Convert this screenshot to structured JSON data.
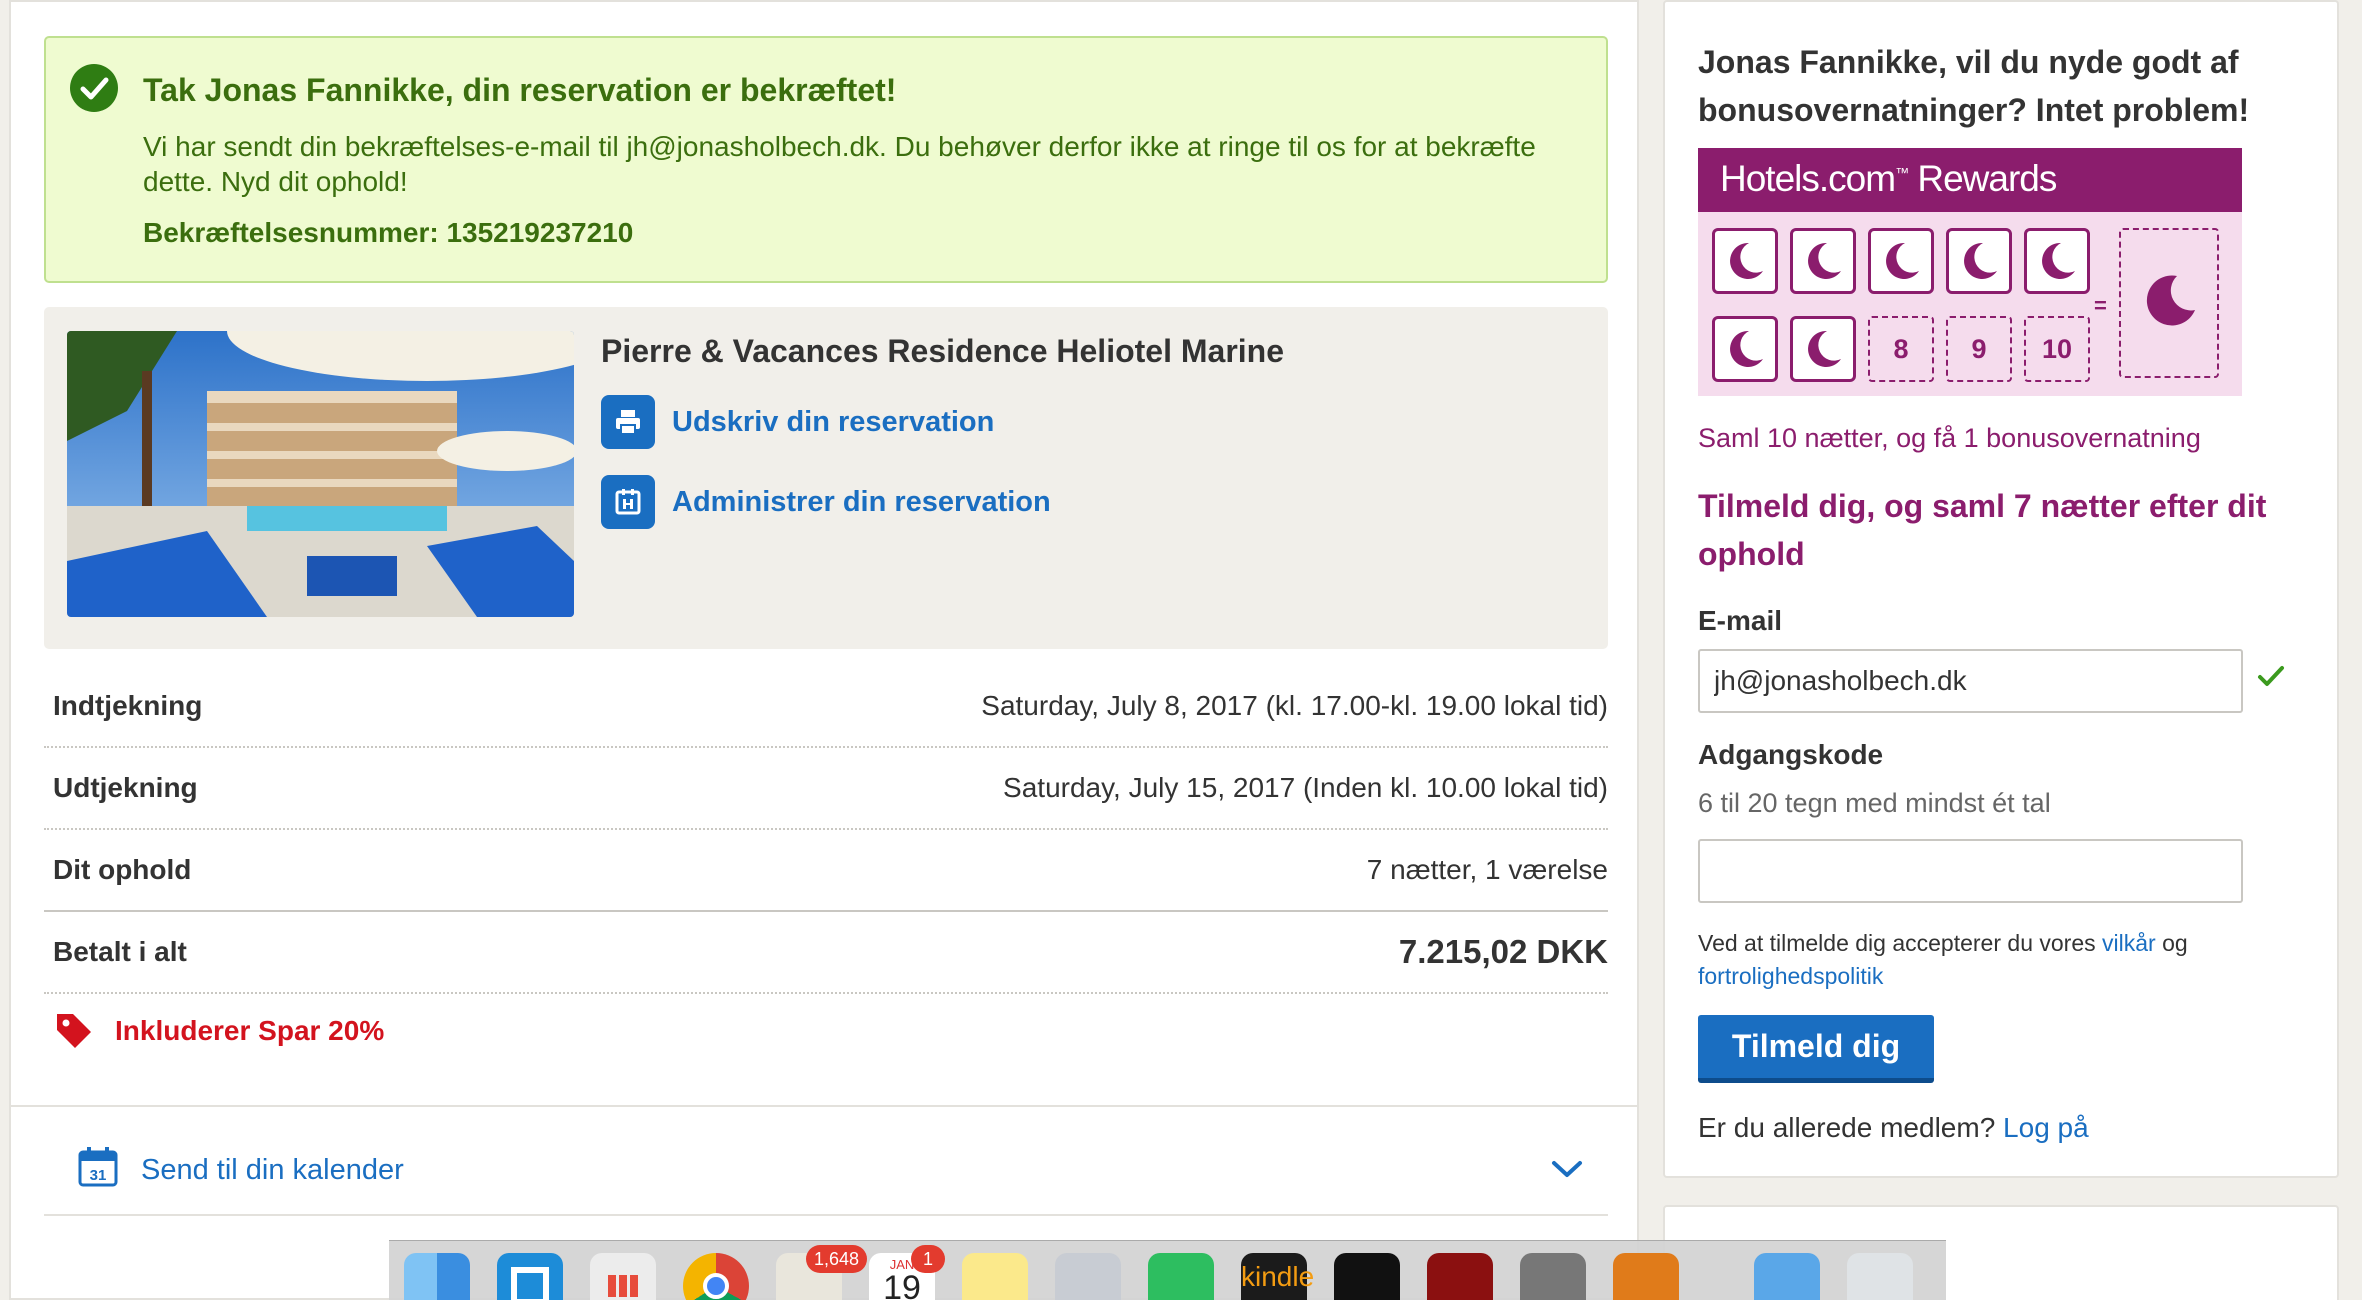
{
  "confirmation": {
    "title": "Tak Jonas Fannikke, din reservation er bekræftet!",
    "message": "Vi har sendt din bekræftelses-e-mail til jh@jonasholbech.dk. Du behøver derfor ikke at ringe til os for at bekræfte dette. Nyd dit ophold!",
    "number_label": "Bekræftelsesnummer: 135219237210"
  },
  "hotel": {
    "name": "Pierre & Vacances Residence Heliotel Marine",
    "print_label": "Udskriv din reservation",
    "manage_label": "Administrer din reservation"
  },
  "details": {
    "checkin": {
      "label": "Indtjekning",
      "value": "Saturday, July 8, 2017 (kl. 17.00-kl. 19.00 lokal tid)"
    },
    "checkout": {
      "label": "Udtjekning",
      "value": "Saturday, July 15, 2017 (Inden kl. 10.00 lokal tid)"
    },
    "stay": {
      "label": "Dit ophold",
      "value": "7 nætter, 1 værelse"
    },
    "total": {
      "label": "Betalt i alt",
      "value": "7.215,02 DKK"
    }
  },
  "discount_label": "Inkluderer Spar 20%",
  "calendar": {
    "label": "Send til din kalender",
    "icon_day": "31"
  },
  "sidebar": {
    "heading": "Jonas Fannikke, vil du nyde godt af bonusovernatninger? Intet problem!",
    "rewards": {
      "brand": "Hotels.com",
      "brand_suffix": "Rewards",
      "tm": "™",
      "empty_nights": [
        "8",
        "9",
        "10"
      ],
      "equals": "=",
      "collected_nights": 7,
      "caption": "Saml 10 nætter, og få 1 bonusovernatning"
    },
    "signup_heading": "Tilmeld dig, og saml 7 nætter efter dit ophold",
    "email_label": "E-mail",
    "email_value": "jh@jonasholbech.dk",
    "password_label": "Adgangskode",
    "password_hint": "6 til 20 tegn med mindst ét tal",
    "password_value": "",
    "terms_prefix": "Ved at tilmelde dig accepterer du vores ",
    "terms_link": "vilkår",
    "terms_and": " og",
    "privacy_link": "fortrolighedspolitik",
    "submit_label": "Tilmeld dig",
    "member_prefix": "Er du allerede medlem? ",
    "login_link": "Log på"
  },
  "dock": {
    "mail_badge": "1,648",
    "calendar_badge": "1",
    "calendar_month": "JAN",
    "calendar_day": "19",
    "kindle_label": "kindle"
  },
  "colors": {
    "brand_blue": "#1a6ec1",
    "rewards_purple": "#8b1d6d",
    "success_green": "#3b6e0e",
    "discount_red": "#d3131e"
  }
}
